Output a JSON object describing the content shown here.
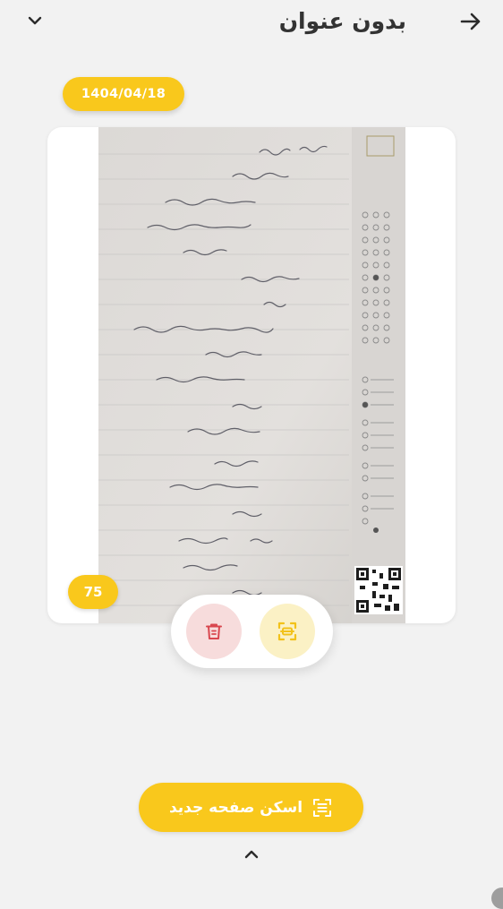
{
  "header": {
    "title": "بدون عنوان",
    "back_icon": "arrow-right-icon",
    "collapse_icon": "chevron-down-icon"
  },
  "document": {
    "date": "1404/04/18",
    "page_number": "75"
  },
  "actions": {
    "delete_icon": "trash-icon",
    "crop_icon": "crop-scan-icon"
  },
  "scan_button": {
    "label": "اسکن صفحه جدید",
    "icon": "scan-icon"
  },
  "footer": {
    "expand_icon": "chevron-up-icon"
  },
  "colors": {
    "accent": "#f9c81c",
    "background": "#f2f2f2",
    "delete_bg": "#f7dcdc",
    "delete_icon": "#d9474f",
    "crop_bg": "#fbf1c5",
    "crop_icon": "#f2c21a"
  }
}
